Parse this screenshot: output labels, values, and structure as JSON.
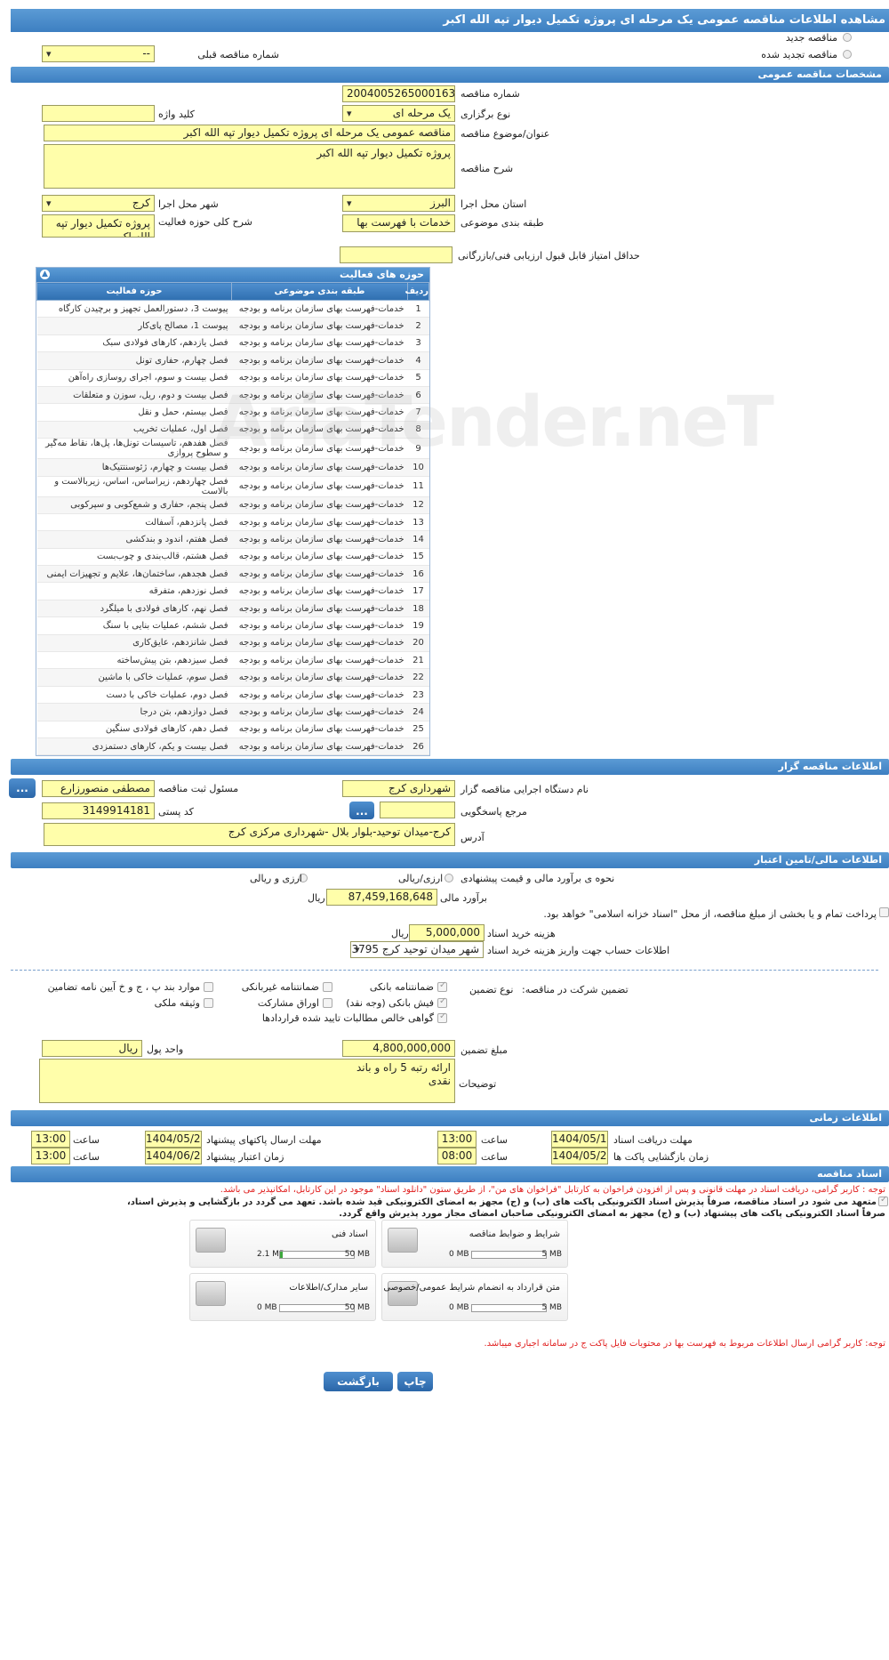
{
  "title": "مشاهده اطلاعات مناقصه عمومی یک مرحله ای پروژه تکمیل دیوار تپه الله اکبر",
  "top": {
    "new": "مناقصه جدید",
    "renew": "مناقصه تجدید شده",
    "prev_label": "شماره مناقصه قبلی",
    "prev_value": "--"
  },
  "general": {
    "header": "مشخصات مناقصه عمومی",
    "number_label": "شماره مناقصه",
    "number": "2004005265000163",
    "type_label": "نوع برگزاری",
    "type": "یک مرحله ای",
    "keyword_label": "کلید واژه",
    "subject_label": "عنوان/موضوع مناقصه",
    "subject": "مناقصه عمومی یک مرحله ای پروژه تکمیل دیوار تپه الله اکبر",
    "desc_label": "شرح مناقصه",
    "desc": "پروژه تکمیل دیوار تپه الله اکبر",
    "province_label": "استان محل اجرا",
    "province": "البرز",
    "city_label": "شهر محل اجرا",
    "city": "کرج",
    "category_label": "طبقه بندی موضوعی",
    "category": "خدمات با فهرست بها",
    "scope_label": "شرح کلی حوزه فعالیت",
    "scope": "پروژه تکمیل دیوار تپه الله اکبر",
    "min_score_label": "حداقل امتیاز قابل قبول ارزیابی فنی/بازرگانی"
  },
  "activity": {
    "header": "حوزه های فعالیت",
    "col_row": "ردیف",
    "col_cat": "طبقه بندی موضوعی",
    "col_field": "حوزه فعالیت",
    "cat": "خدمات-فهرست بهای سازمان برنامه و بودجه",
    "rows": [
      "پیوست 3، دستورالعمل تجهیز و برچیدن کارگاه",
      "پیوست 1، مصالح پای‌کار",
      "فصل یازدهم، کارهای فولادی سبک",
      "فصل چهارم، حفاری تونل",
      "فصل بیست و سوم، اجرای روسازی راه‌آهن",
      "فصل بیست و دوم، ریل، سوزن و متعلقات",
      "فصل بیستم، حمل و نقل",
      "فصل اول، عملیات تخریب",
      "فصل هفدهم، تاسیسات تونل‌ها، پل‌ها، نقاط مه‌گیر و سطوح پروازی",
      "فصل بیست و چهارم، ژئوسنتتیک‌ها",
      "فصل چهاردهم، زیراساس، اساس، زیربالاست و بالاست",
      "فصل پنجم، حفاری و شمع‌کوبی و سپرکوبی",
      "فصل پانزدهم، آسفالت",
      "فصل هفتم، اندود و بندکشی",
      "فصل هشتم، قالب‌بندی و چوب‌بست",
      "فصل هجدهم، ساختمان‌ها، علایم و تجهیزات ایمنی",
      "فصل نوزدهم، متفرقه",
      "فصل نهم، کارهای فولادی با میلگرد",
      "فصل ششم، عملیات بنایی با سنگ",
      "فصل شانزدهم، عایق‌کاری",
      "فصل سیزدهم، بتن پیش‌ساخته",
      "فصل سوم، عملیات خاکی با ماشین",
      "فصل دوم، عملیات خاکی با دست",
      "فصل دوازدهم، بتن درجا",
      "فصل دهم، کارهای فولادی سنگین",
      "فصل بیست و یکم، کارهای دستمزدی"
    ]
  },
  "organizer": {
    "header": "اطلاعات مناقصه گزار",
    "org_label": "نام دستگاه اجرایی مناقصه گزار",
    "org": "شهرداری کرج",
    "resp_label": "مسئول ثبت مناقصه",
    "resp": "مصطفی منصورزارع",
    "ref_label": "مرجع پاسخگویی",
    "postal_label": "کد پستی",
    "postal": "3149914181",
    "addr_label": "آدرس",
    "addr": "کرج-میدان توحید-بلوار بلال -شهرداری مرکزی کرج",
    "more": "..."
  },
  "finance": {
    "header": "اطلاعات مالی/تامین اعتبار",
    "method_label": "نحوه ی برآورد مالی و قیمت پیشنهادی",
    "opt1": "ارزی/ریالی",
    "opt2": "ارزی و ریالی",
    "est_label": "برآورد مالی",
    "est": "87,459,168,648",
    "unit": "ریال",
    "note": "پرداخت تمام و یا بخشی از مبلغ مناقصه، از محل \"اسناد خزانه اسلامی\" خواهد بود.",
    "doc_cost_label": "هزینه خرید اسناد",
    "doc_cost": "5,000,000",
    "account_label": "اطلاعات حساب جهت واریز هزینه خرید اسناد",
    "account": "شهر میدان توحید کرج 3795."
  },
  "guarantee": {
    "label": "تضمین شرکت در مناقصه:",
    "type_label": "نوع تضمین",
    "items": [
      "ضمانتنامه بانکی",
      "ضمانتنامه غیربانکی",
      "موارد بند پ ، ج و خ آیین نامه تضامین",
      "فیش بانکی (وجه نقد)",
      "اوراق مشارکت",
      "وثیقه ملکی",
      "گواهی خالص مطالبات تایید شده قراردادها"
    ],
    "amount_label": "مبلغ تضمین",
    "amount": "4,800,000,000",
    "currency_label": "واحد پول",
    "currency": "ریال",
    "notes_label": "توضیحات",
    "notes1": "ارائه رتبه 5 راه و باند",
    "notes2": "نقدی"
  },
  "timing": {
    "header": "اطلاعات زمانی",
    "receive_label": "مهلت دریافت اسناد",
    "receive_date": "1404/05/11",
    "receive_time": "13:00",
    "submit_label": "مهلت ارسال پاکتهای پیشنهاد",
    "submit_date": "1404/05/21",
    "submit_time": "13:00",
    "open_label": "زمان بازگشایی پاکت ها",
    "open_date": "1404/05/22",
    "open_time": "08:00",
    "valid_label": "زمان اعتبار پیشنهاد",
    "valid_date": "1404/06/22",
    "valid_time": "13:00",
    "time_label": "ساعت"
  },
  "docs": {
    "header": "اسناد مناقصه",
    "note1": "توجه : کاربر گرامی، دریافت اسناد در مهلت قانونی و پس از افزودن فراخوان به کارتابل \"فراخوان های من\"، از طریق ستون \"دانلود اسناد\" موجود در این کارتابل، امکانپذیر می باشد.",
    "note2": "متعهد می شود در اسناد مناقصه، صرفاً پذیرش اسناد الکترونیکی پاکت های (ب) و (ج) مجهز به امضای الکترونیکی قید شده باشد. تعهد می گردد در بازگشایی و پذیرش اسناد،",
    "note3": "صرفاً اسناد الکترونیکی پاکت های پیشنهاد (ب) و (ج) مجهز به امضای الکترونیکی صاحبان امضای مجاز مورد پذیرش واقع گردد.",
    "files": [
      {
        "name": "شرایط و ضوابط مناقصه",
        "min": "0 MB",
        "max": "5 MB",
        "fill": 0
      },
      {
        "name": "اسناد فنی",
        "min": "2.1 MB",
        "max": "50 MB",
        "fill": 0.042
      },
      {
        "name": "متن قرارداد به انضمام شرایط عمومی/خصوصی",
        "min": "0 MB",
        "max": "5 MB",
        "fill": 0
      },
      {
        "name": "سایر مدارک/اطلاعات",
        "min": "0 MB",
        "max": "50 MB",
        "fill": 0
      }
    ],
    "note4": "توجه: کاربر گرامی ارسال اطلاعات مربوط به فهرست بها در محتویات فایل پاکت ج در سامانه اجباری میباشد."
  },
  "buttons": {
    "print": "چاپ",
    "back": "بازگشت"
  },
  "watermark": "AriaTender.neT"
}
